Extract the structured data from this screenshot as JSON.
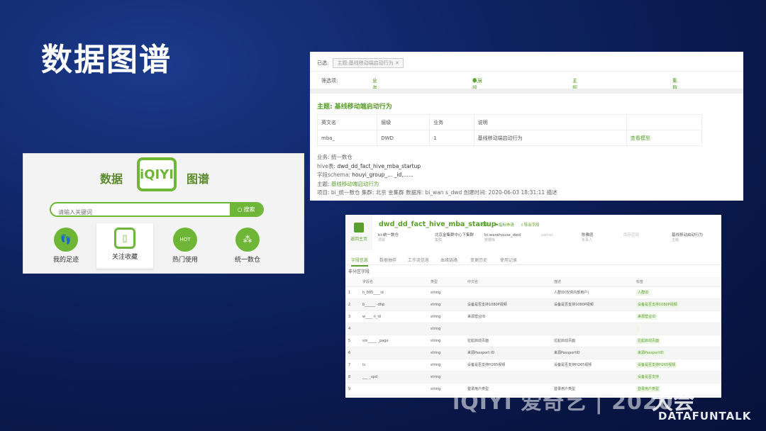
{
  "slide": {
    "title": "数据图谱"
  },
  "portal": {
    "brand_left": "数据",
    "logo_text": "iQIYI",
    "brand_right": "图谱",
    "search_placeholder": "请输入关键词",
    "search_button": "搜索",
    "features": [
      {
        "label": "我的足迹",
        "icon": "footprint-icon"
      },
      {
        "label": "关注收藏",
        "icon": "bookmark-icon"
      },
      {
        "label": "热门使用",
        "icon": "hot-flame-icon",
        "icon_text": "HOT"
      },
      {
        "label": "统一数仓",
        "icon": "network-nodes-icon"
      }
    ],
    "accent": "#6fb637"
  },
  "search_results": {
    "selected_label": "已选:",
    "selected_chip": "主题:基线移动端启动行为",
    "filter_label": "筛选项:",
    "filters": [
      "业务",
      "表层级",
      "主题",
      "集群"
    ],
    "topic_heading": "主题:  基线移动端启动行为",
    "table": {
      "headers": [
        "英文名",
        "层级",
        "业务",
        "说明",
        ""
      ],
      "row": [
        "mba_",
        "DWD",
        "1",
        "基线移动端启动行为",
        "查看模型"
      ]
    },
    "meta": {
      "business": "业务:  统一数仓",
      "hive_label": "hive表:",
      "hive_value": "dwd_dd_fact_hive_mba_startup",
      "schema_label": "字段schema:",
      "schema_value": "houyi_group_...    _id,......",
      "topic_label": "主题:",
      "topic_value": "基线移动端启动行为",
      "details": "项目: bi_统一数仓   集群: 北京    金集群   数据库: bi_wan      s_dwd   创建时间: 2020-06-03 18:31:11   描述"
    }
  },
  "table_detail": {
    "home_label": "返回主页",
    "title": "dwd_dd_fact_hive_mba_startup",
    "actions": [
      "收藏",
      "指标申请",
      "导出字段"
    ],
    "info": [
      {
        "value": "bi-统一数仓",
        "sub": "项目"
      },
      {
        "value": "北京金集群中心下集群",
        "sub": "集群"
      },
      {
        "value": "bi.warehouse_dwd",
        "sub": "数据库"
      },
      {
        "value": "owner",
        "sub": ""
      },
      {
        "value": "陈雅庭",
        "sub": "负责人"
      },
      {
        "value": "库存空间",
        "sub": ""
      },
      {
        "value": "基线移动启动行为",
        "sub": "主题"
      }
    ],
    "tabs": [
      "字段信息",
      "数据抽样",
      "工作流信息",
      "血缘链路",
      "变更历史",
      "使用记录"
    ],
    "sub_label": "非分区字段",
    "columns": [
      "",
      "字段名",
      "类型",
      "中文名",
      "描述",
      "标签"
    ],
    "rows": [
      {
        "no": "1",
        "name": "h_005____id",
        "type": "string",
        "cn": "",
        "desc": "人群ID(仅供内部用户)",
        "tag": "人群ID"
      },
      {
        "no": "2",
        "name": "b______ -dtip",
        "type": "string",
        "cn": "设备是否支持1080P视频",
        "desc": "设备是否支持1080P视频",
        "tag": "设备是否支持1080P视频"
      },
      {
        "no": "3",
        "name": "w____ n_id",
        "type": "string",
        "cn": "来源营业ID",
        "desc": "",
        "tag": "来源营业ID"
      },
      {
        "no": "4",
        "name": "",
        "type": "string",
        "cn": "",
        "desc": "",
        "tag": ""
      },
      {
        "no": "5",
        "name": "sm_____ _page",
        "type": "string",
        "cn": "拉起启动页面",
        "desc": "拉起启动页面",
        "tag": "拉起启动页面"
      },
      {
        "no": "6",
        "name": "",
        "type": "string",
        "cn": "来源Passport ID",
        "desc": "来源PassportID",
        "tag": "来源PassportID"
      },
      {
        "no": "7",
        "name": "is",
        "type": "string",
        "cn": "设备是否支持H265视频",
        "desc": "设备是否支持H265视频",
        "tag": "设备是否支持H265视频"
      },
      {
        "no": "8",
        "name": "___ _upd",
        "type": "string",
        "cn": "",
        "desc": "",
        "tag": "设备是否支持"
      },
      {
        "no": "9",
        "name": "",
        "type": "string",
        "cn": "登录用户类型",
        "desc": "登录用户类型",
        "tag": "登录用户类型"
      }
    ]
  },
  "watermark": {
    "text_a": "iQIYI 爱奇艺 | 2020",
    "text_b": "大会",
    "text_c": "DATAFUNTALK"
  }
}
